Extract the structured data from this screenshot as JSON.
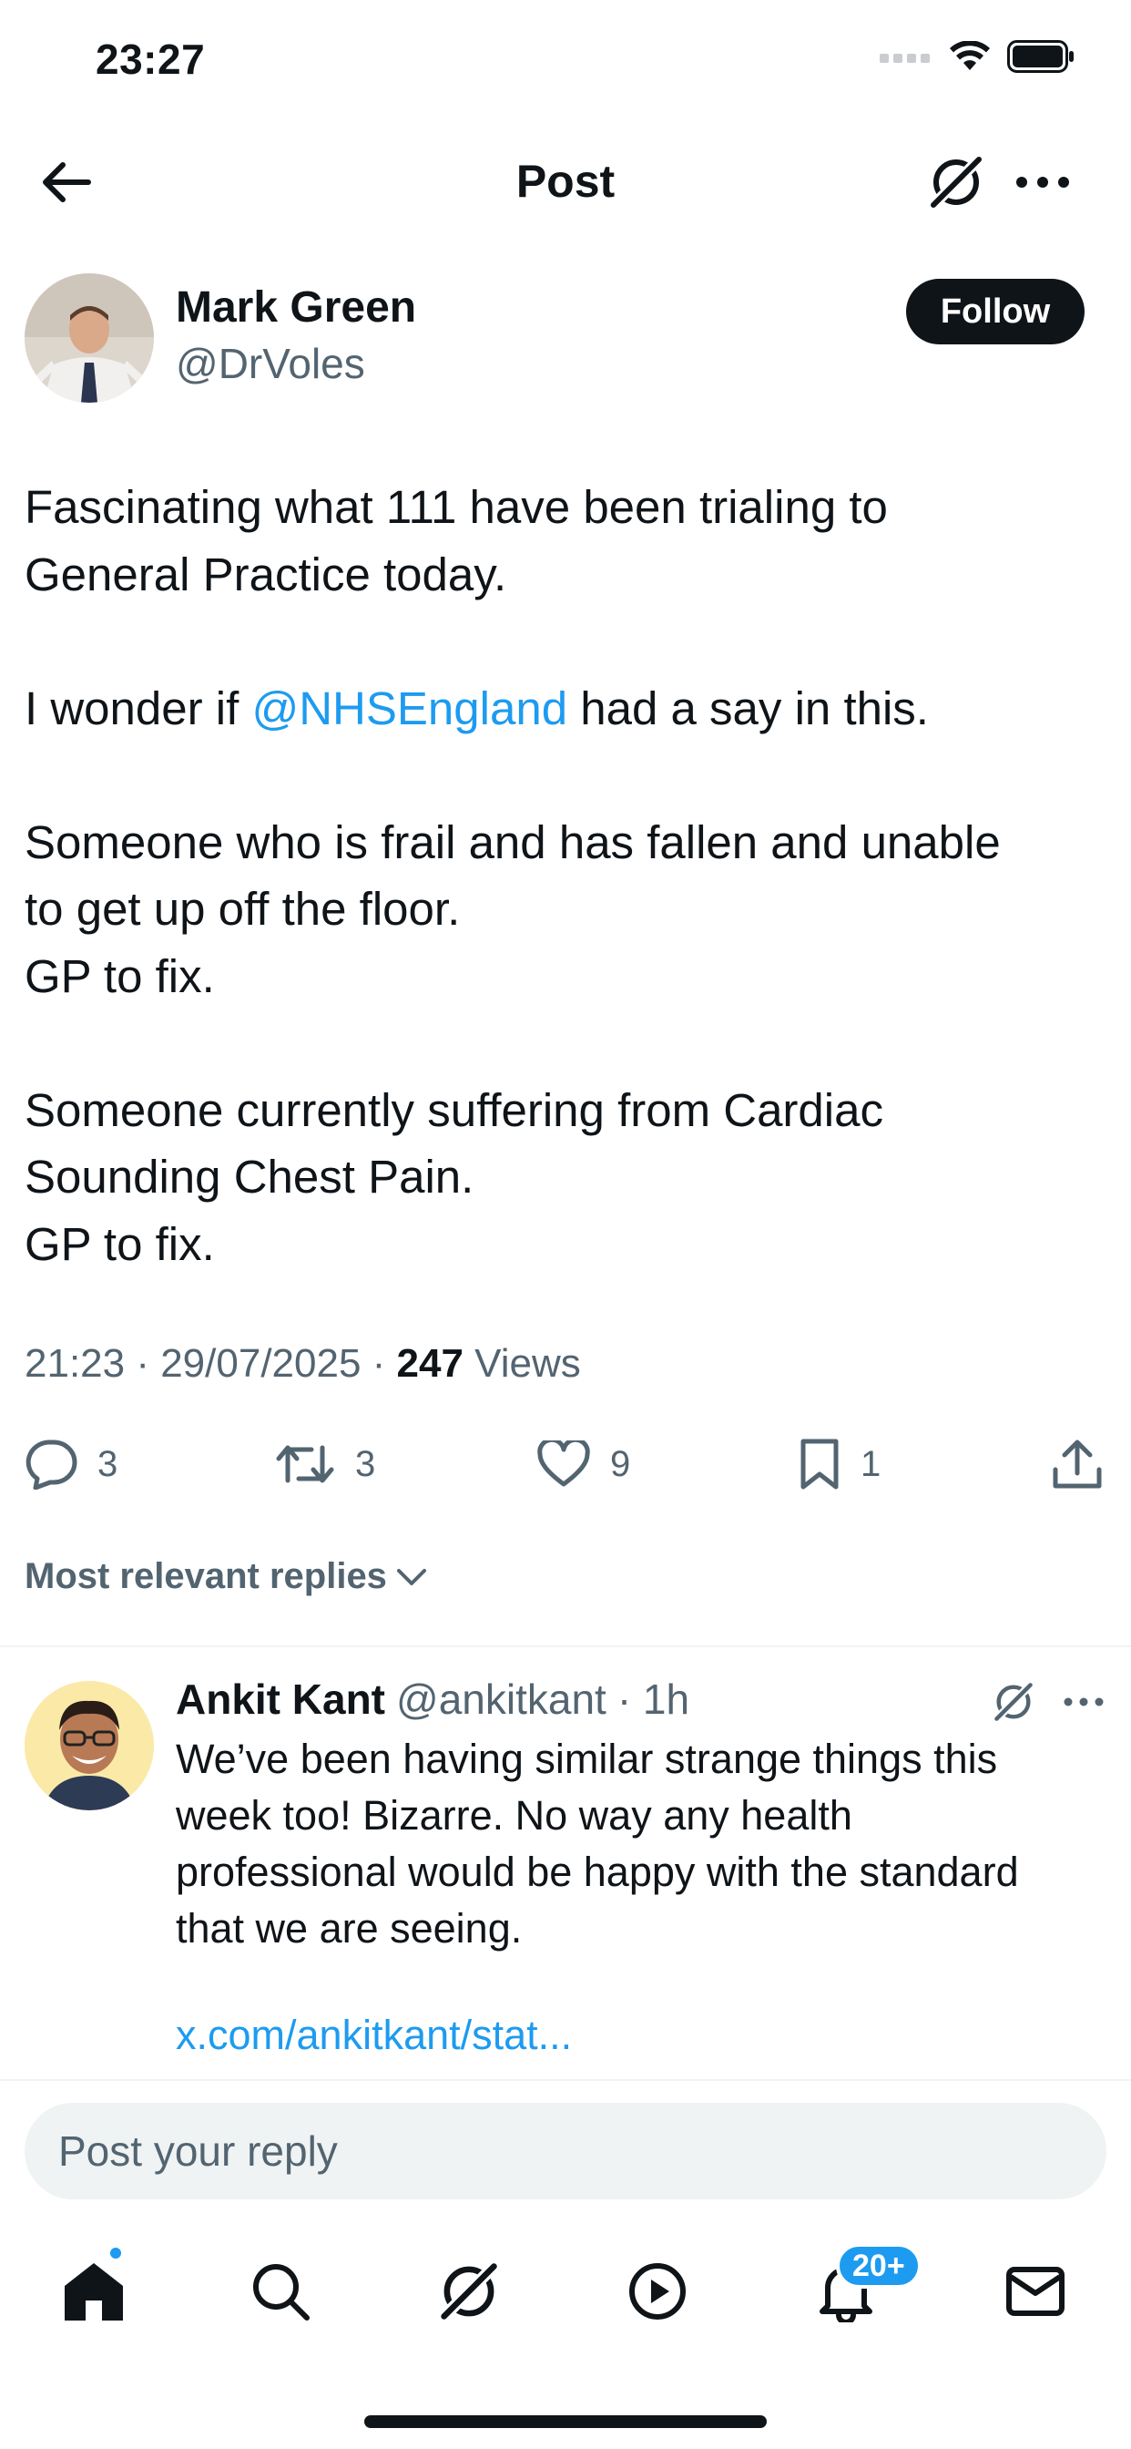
{
  "status_bar": {
    "time": "23:27"
  },
  "header": {
    "title": "Post"
  },
  "post": {
    "author_name": "Mark Green",
    "author_handle": "@DrVoles",
    "follow_label": "Follow",
    "paragraphs": [
      [
        "Fascinating what 111 have been trialing to",
        "General Practice today."
      ],
      [
        "I wonder if ",
        "@NHSEngland",
        " had a say in this."
      ],
      [
        "Someone who is frail and has fallen and unable",
        "to get up off the floor.",
        "GP to fix."
      ],
      [
        "Someone currently suffering from Cardiac",
        "Sounding Chest Pain.",
        "GP to fix."
      ]
    ],
    "timestamp": "21:23 · 29/07/2025 · ",
    "views_count": "247",
    "views_label": " Views",
    "stats": {
      "replies": "3",
      "reposts": "3",
      "likes": "9",
      "bookmarks": "1"
    }
  },
  "replies_sort_label": "Most relevant replies",
  "reply": {
    "name": "Ankit Kant",
    "handle": "@ankitkant",
    "time": "· 1h",
    "lines": [
      "We’ve been having similar strange things this",
      "week too! Bizarre. No way any health",
      "professional would be happy with the standard",
      "that we are seeing."
    ],
    "link": "x.com/ankitkant/stat..."
  },
  "composer": {
    "placeholder": "Post your reply"
  },
  "tabbar": {
    "notifications_badge": "20+"
  },
  "colors": {
    "accent": "#1d9bf0",
    "text": "#0f1419",
    "muted": "#536471"
  }
}
